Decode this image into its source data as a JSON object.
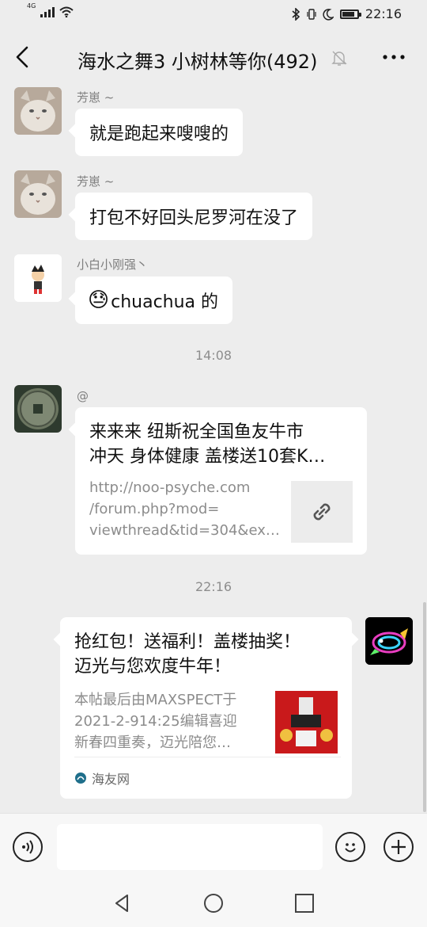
{
  "status_bar": {
    "network": "4G",
    "time": "22:16",
    "battery_level": 0.85
  },
  "header": {
    "title": "海水之舞3 小树林等你(492)"
  },
  "messages": [
    {
      "type": "text",
      "sender": "芳崽 ~",
      "text": "就是跑起来嗖嗖的"
    },
    {
      "type": "text",
      "sender": "芳崽 ~",
      "text": "打包不好回头尼罗河在没了"
    },
    {
      "type": "text",
      "sender": "小白小刚强丶",
      "emoji": "😓",
      "text": "chuachua 的"
    },
    {
      "type": "time",
      "text": "14:08"
    },
    {
      "type": "link",
      "sender": "@",
      "title_line1": "来来来 纽斯祝全国鱼友牛市",
      "title_line2": "冲天 身体健康 盖楼送10套K…",
      "desc_line1": "http://noo-psyche.com",
      "desc_line2": "/forum.php?mod=",
      "desc_line3": "viewthread&tid=304&ex…"
    },
    {
      "type": "time",
      "text": "22:16"
    },
    {
      "type": "link_self",
      "title_line1": "抢红包！送福利！盖楼抽奖！",
      "title_line2": "迈光与您欢度牛年！",
      "desc_line1": "本帖最后由MAXSPECT于",
      "desc_line2": "2021-2-914:25编辑喜迎",
      "desc_line3": "新春四重奏，迈光陪您…",
      "source": "海友网"
    }
  ]
}
